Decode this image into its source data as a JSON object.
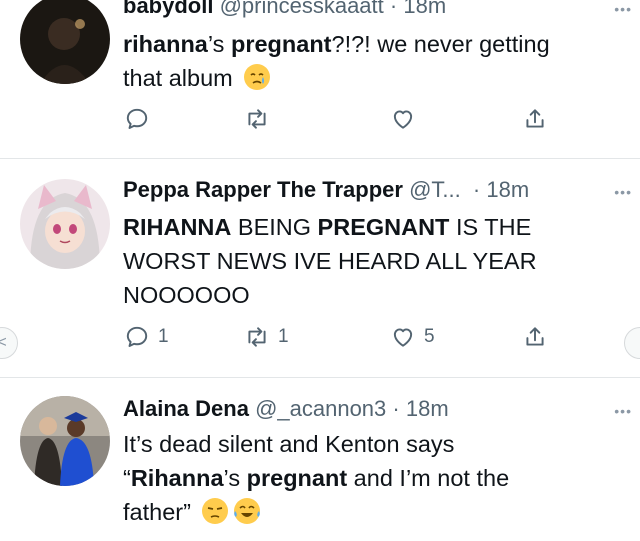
{
  "colors": {
    "icon": "#536471",
    "text": "#0f1419",
    "divider": "#e3e6e8"
  },
  "nav": {
    "prev_icon": "chevron-left-icon",
    "next_icon": "chevron-right-icon",
    "prev_label": "<"
  },
  "tweets": [
    {
      "name": "babydoll",
      "handle": "@princesskaaatt",
      "sep": "·",
      "time": "18m",
      "more": "•••",
      "text_parts": [
        "rihanna",
        "’s ",
        "pregnant",
        "?!?! we never getting",
        "that album"
      ],
      "emoji": "crying-face",
      "actions": {
        "reply": "",
        "retweet": "",
        "like": ""
      }
    },
    {
      "name": "Peppa Rapper The Trapper",
      "handle": "@T...",
      "sep": "·",
      "time": "18m",
      "more": "•••",
      "text_parts": [
        "RIHANNA",
        " BEING ",
        "PREGNANT",
        " IS THE",
        "WORST NEWS IVE HEARD ALL YEAR",
        "NOOOOOO"
      ],
      "actions": {
        "reply": "1",
        "retweet": "1",
        "like": "5"
      }
    },
    {
      "name": "Alaina Dena",
      "handle": "@_acannon3",
      "sep": "·",
      "time": "18m",
      "more": "•••",
      "text_parts": [
        "It’s dead silent and Kenton says",
        "“",
        "Rihanna",
        "’s ",
        "pregnant",
        " and I’m not the",
        "father”"
      ],
      "emoji": [
        "unamused-face",
        "laughing-tears-face"
      ]
    }
  ]
}
